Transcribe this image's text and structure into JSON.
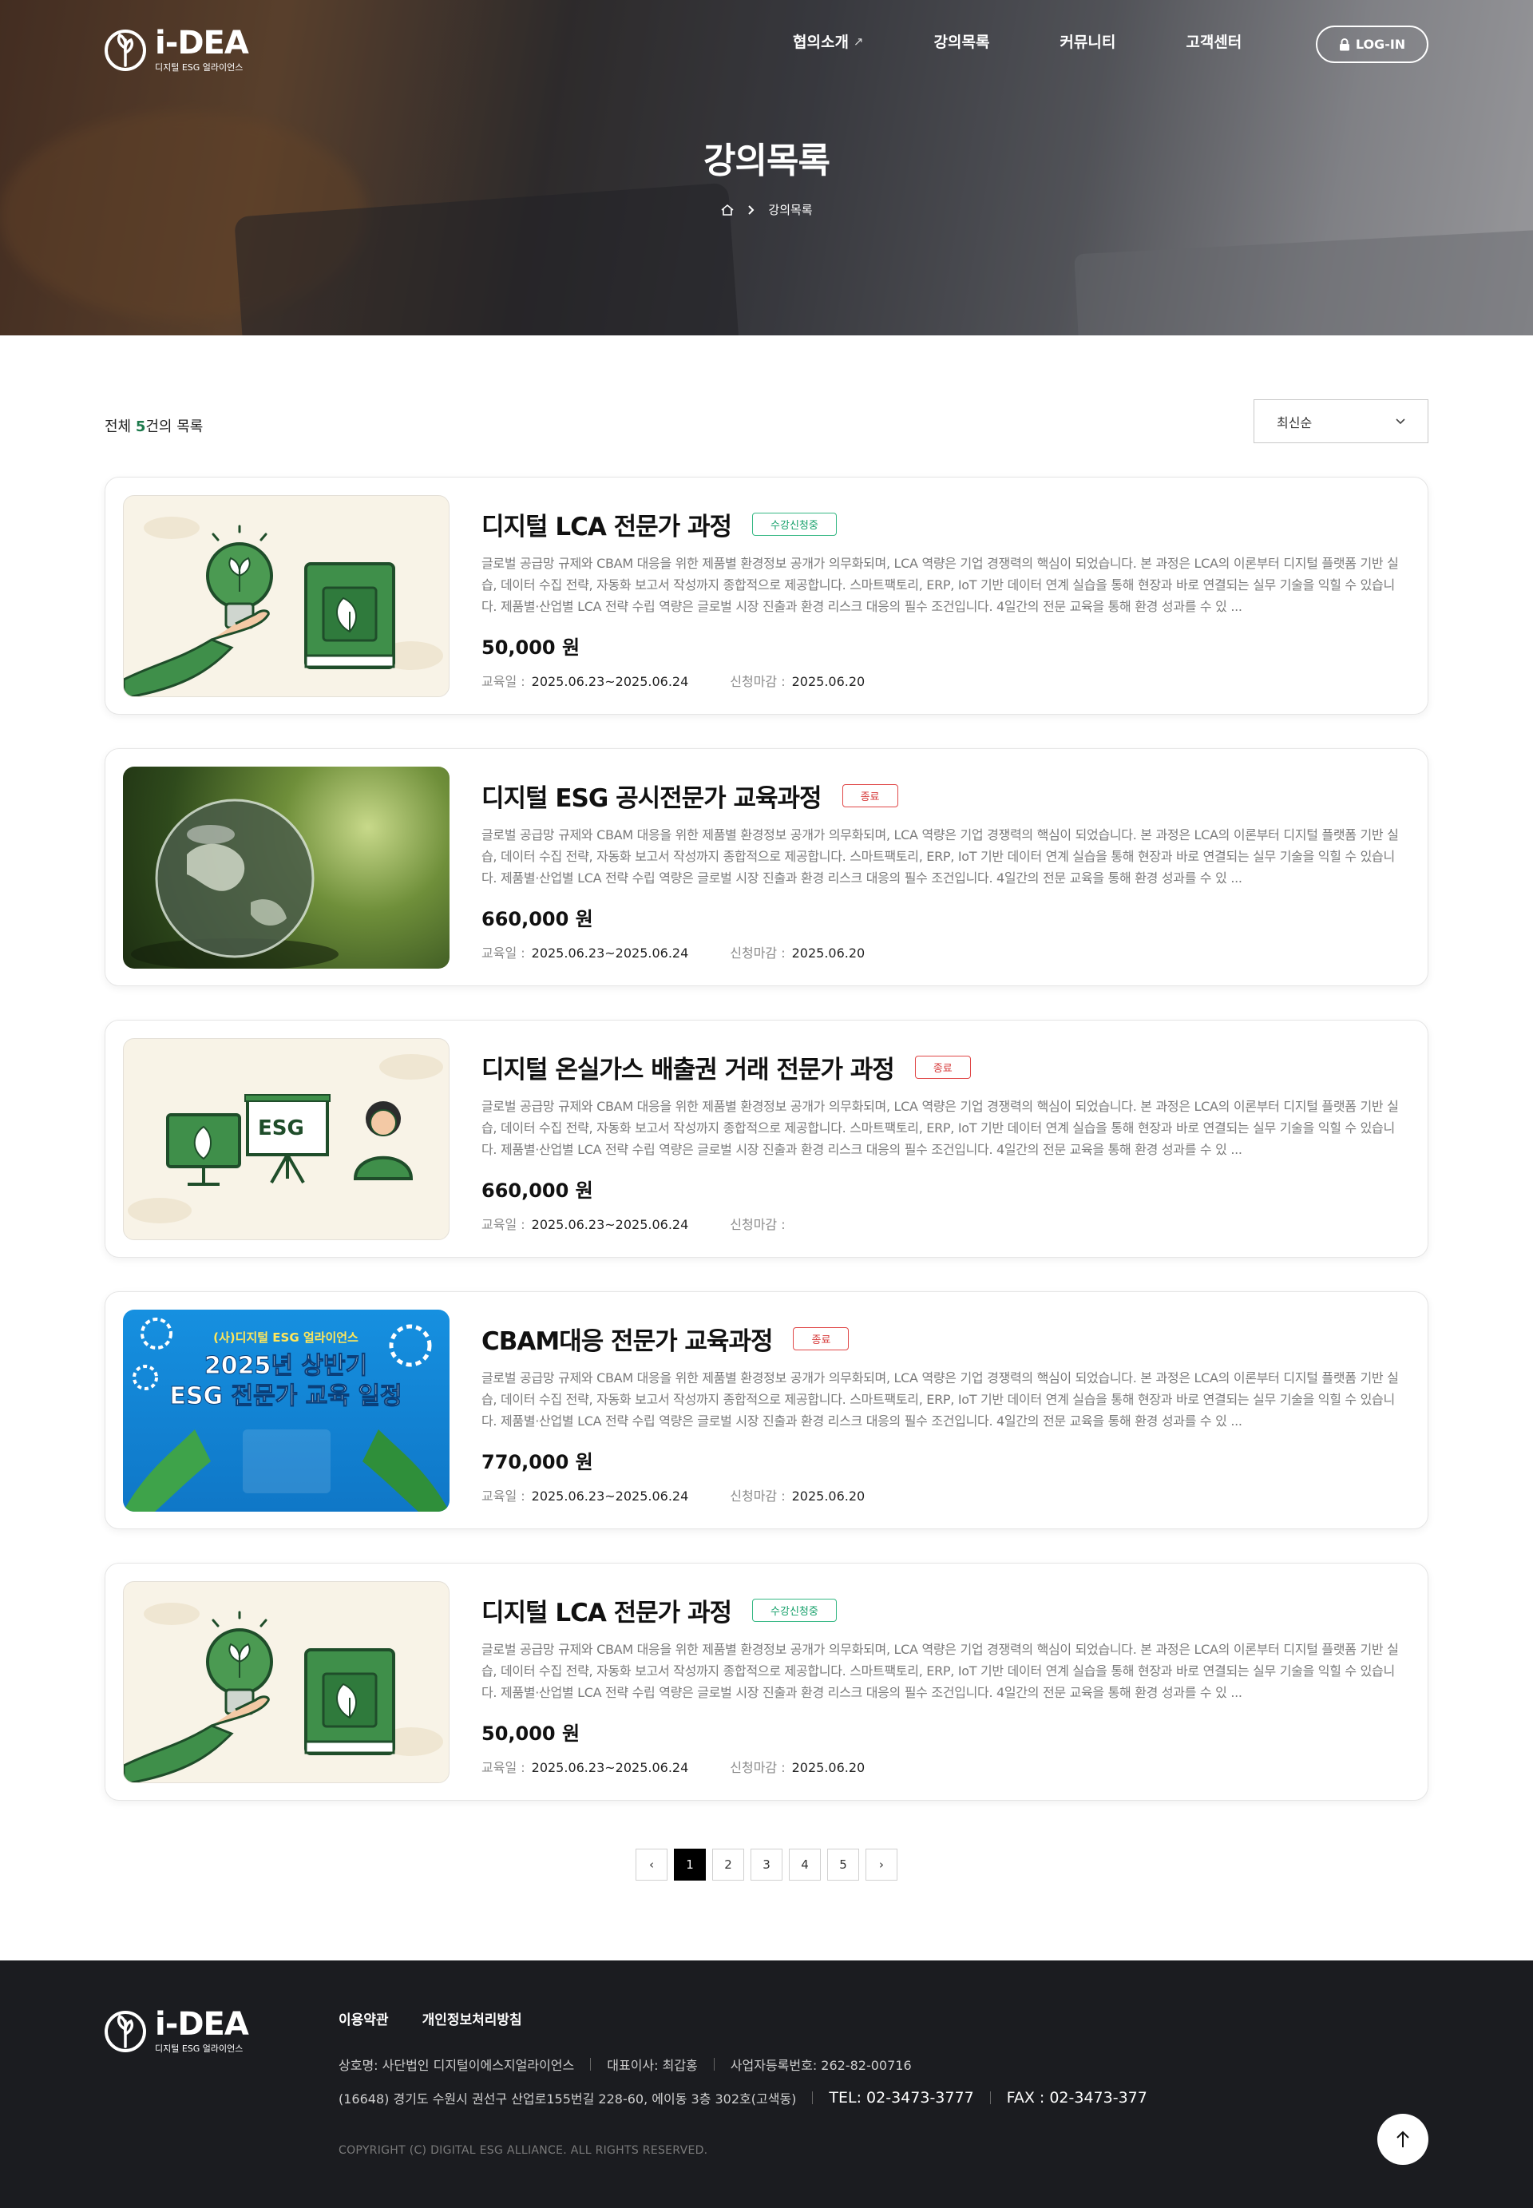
{
  "header": {
    "brand": "i-DEA",
    "brand_sub": "디지털 ESG 얼라이언스",
    "nav": [
      {
        "label": "협의소개",
        "ext": "↗"
      },
      {
        "label": "강의목록"
      },
      {
        "label": "커뮤니티"
      },
      {
        "label": "고객센터"
      }
    ],
    "login_label": "LOG-IN"
  },
  "hero": {
    "title": "강의목록",
    "breadcrumb_current": "강의목록"
  },
  "list": {
    "count_prefix": "전체 ",
    "count_value": "5",
    "count_suffix": "건의 목록",
    "sort_label": "최신순"
  },
  "colors": {
    "accent_green": "#1d7a4c",
    "badge_green": "#36b884",
    "badge_red": "#e04848",
    "footer_bg": "#1b1c20"
  },
  "courses": [
    {
      "title": "디지털 LCA 전문가 과정",
      "badge": "수강신청중",
      "badge_type": "green",
      "thumb": "bulb-book",
      "desc": "글로벌 공급망 규제와 CBAM 대응을 위한 제품별 환경정보 공개가 의무화되며, LCA 역량은 기업 경쟁력의 핵심이 되었습니다. 본 과정은 LCA의 이론부터 디지털 플랫폼 기반 실습, 데이터 수집 전략, 자동화 보고서 작성까지 종합적으로 제공합니다. 스마트팩토리, ERP, IoT 기반 데이터 연계 실습을 통해 현장과 바로 연결되는 실무 기술을 익힐 수 있습니다. 제품별·산업별 LCA 전략 수립 역량은 글로벌 시장 진출과 환경 리스크 대응의 필수 조건입니다. 4일간의 전문 교육을 통해 환경 성과를 수 있 ...",
      "price": "50,000 원",
      "edu_label": "교육일 :",
      "edu_date": "2025.06.23~2025.06.24",
      "deadline_label": "신청마감 :",
      "deadline": "2025.06.20"
    },
    {
      "title": "디지털 ESG 공시전문가 교육과정",
      "badge": "종료",
      "badge_type": "red",
      "thumb": "glass-globe",
      "desc": "글로벌 공급망 규제와 CBAM 대응을 위한 제품별 환경정보 공개가 의무화되며, LCA 역량은 기업 경쟁력의 핵심이 되었습니다. 본 과정은 LCA의 이론부터 디지털 플랫폼 기반 실습, 데이터 수집 전략, 자동화 보고서 작성까지 종합적으로 제공합니다. 스마트팩토리, ERP, IoT 기반 데이터 연계 실습을 통해 현장과 바로 연결되는 실무 기술을 익힐 수 있습니다. 제품별·산업별 LCA 전략 수립 역량은 글로벌 시장 진출과 환경 리스크 대응의 필수 조건입니다. 4일간의 전문 교육을 통해 환경 성과를 수 있 ...",
      "price": "660,000 원",
      "edu_label": "교육일 :",
      "edu_date": "2025.06.23~2025.06.24",
      "deadline_label": "신청마감 :",
      "deadline": "2025.06.20"
    },
    {
      "title": "디지털 온실가스 배출권 거래 전문가 과정",
      "badge": "종료",
      "badge_type": "red",
      "thumb": "esg-presentation",
      "thumb_text": "ESG",
      "desc": "글로벌 공급망 규제와 CBAM 대응을 위한 제품별 환경정보 공개가 의무화되며, LCA 역량은 기업 경쟁력의 핵심이 되었습니다. 본 과정은 LCA의 이론부터 디지털 플랫폼 기반 실습, 데이터 수집 전략, 자동화 보고서 작성까지 종합적으로 제공합니다. 스마트팩토리, ERP, IoT 기반 데이터 연계 실습을 통해 현장과 바로 연결되는 실무 기술을 익힐 수 있습니다. 제품별·산업별 LCA 전략 수립 역량은 글로벌 시장 진출과 환경 리스크 대응의 필수 조건입니다. 4일간의 전문 교육을 통해 환경 성과를 수 있 ...",
      "price": "660,000 원",
      "edu_label": "교육일 :",
      "edu_date": "2025.06.23~2025.06.24",
      "deadline_label": "신청마감 :",
      "deadline": ""
    },
    {
      "title": "CBAM대응 전문가 교육과정",
      "badge": "종료",
      "badge_type": "red",
      "thumb": "poster",
      "thumb_line1": "(사)디지털 ESG 얼라이언스",
      "thumb_line2": "2025년 상반기",
      "thumb_line3": "ESG 전문가 교육 일정",
      "desc": "글로벌 공급망 규제와 CBAM 대응을 위한 제품별 환경정보 공개가 의무화되며, LCA 역량은 기업 경쟁력의 핵심이 되었습니다. 본 과정은 LCA의 이론부터 디지털 플랫폼 기반 실습, 데이터 수집 전략, 자동화 보고서 작성까지 종합적으로 제공합니다. 스마트팩토리, ERP, IoT 기반 데이터 연계 실습을 통해 현장과 바로 연결되는 실무 기술을 익힐 수 있습니다. 제품별·산업별 LCA 전략 수립 역량은 글로벌 시장 진출과 환경 리스크 대응의 필수 조건입니다. 4일간의 전문 교육을 통해 환경 성과를 수 있 ...",
      "price": "770,000 원",
      "edu_label": "교육일 :",
      "edu_date": "2025.06.23~2025.06.24",
      "deadline_label": "신청마감 :",
      "deadline": "2025.06.20"
    },
    {
      "title": "디지털 LCA 전문가 과정",
      "badge": "수강신청중",
      "badge_type": "green",
      "thumb": "bulb-book",
      "desc": "글로벌 공급망 규제와 CBAM 대응을 위한 제품별 환경정보 공개가 의무화되며, LCA 역량은 기업 경쟁력의 핵심이 되었습니다. 본 과정은 LCA의 이론부터 디지털 플랫폼 기반 실습, 데이터 수집 전략, 자동화 보고서 작성까지 종합적으로 제공합니다. 스마트팩토리, ERP, IoT 기반 데이터 연계 실습을 통해 현장과 바로 연결되는 실무 기술을 익힐 수 있습니다. 제품별·산업별 LCA 전략 수립 역량은 글로벌 시장 진출과 환경 리스크 대응의 필수 조건입니다. 4일간의 전문 교육을 통해 환경 성과를 수 있 ...",
      "price": "50,000 원",
      "edu_label": "교육일 :",
      "edu_date": "2025.06.23~2025.06.24",
      "deadline_label": "신청마감 :",
      "deadline": "2025.06.20"
    }
  ],
  "pagination": {
    "prev": "‹",
    "pages": [
      "1",
      "2",
      "3",
      "4",
      "5"
    ],
    "active": "1",
    "next": "›"
  },
  "footer": {
    "brand": "i-DEA",
    "brand_sub": "디지털 ESG 얼라이언스",
    "links": [
      "이용약관",
      "개인정보처리방침"
    ],
    "company": "상호명: 사단법인 디지털이에스지얼라이언스",
    "ceo": "대표이사: 최갑홍",
    "bizno": "사업자등록번호: 262-82-00716",
    "address": "(16648) 경기도 수원시 권선구 산업로155번길 228-60, 에이동 3층 302호(고색동)",
    "tel": "TEL: 02-3473-3777",
    "fax": "FAX : 02-3473-377",
    "copyright": "COPYRIGHT (C) DIGITAL ESG ALLIANCE. ALL RIGHTS RESERVED."
  }
}
